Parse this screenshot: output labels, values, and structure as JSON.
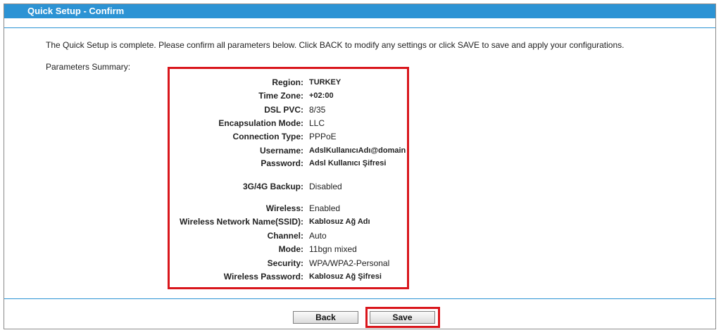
{
  "header": {
    "title": "Quick Setup - Confirm"
  },
  "intro_text": "The Quick Setup is complete. Please confirm all parameters below. Click BACK to modify any settings or click SAVE to save and apply your configurations.",
  "summary_label": "Parameters Summary:",
  "params": [
    {
      "label": "Region:",
      "value": "TURKEY"
    },
    {
      "label": "Time Zone:",
      "value": "+02:00"
    },
    {
      "label": "DSL PVC:",
      "value": "8/35"
    },
    {
      "label": "Encapsulation Mode:",
      "value": "LLC"
    },
    {
      "label": "Connection Type:",
      "value": "PPPoE"
    },
    {
      "label": "Username:",
      "value": "AdslKullanıcıAdı@domain"
    },
    {
      "label": "Password:",
      "value": "Adsl Kullanıcı Şifresi"
    },
    {
      "label": "3G/4G Backup:",
      "value": "Disabled"
    },
    {
      "label": "Wireless:",
      "value": "Enabled"
    },
    {
      "label": "Wireless Network Name(SSID):",
      "value": "Kablosuz Ağ Adı"
    },
    {
      "label": "Channel:",
      "value": "Auto"
    },
    {
      "label": "Mode:",
      "value": "11bgn mixed"
    },
    {
      "label": "Security:",
      "value": "WPA/WPA2-Personal"
    },
    {
      "label": "Wireless Password:",
      "value": "Kablosuz Ağ Şifresi"
    }
  ],
  "buttons": {
    "back_label": "Back",
    "save_label": "Save"
  },
  "colors": {
    "accent": "#2c93d4",
    "highlight": "#d9161c"
  }
}
